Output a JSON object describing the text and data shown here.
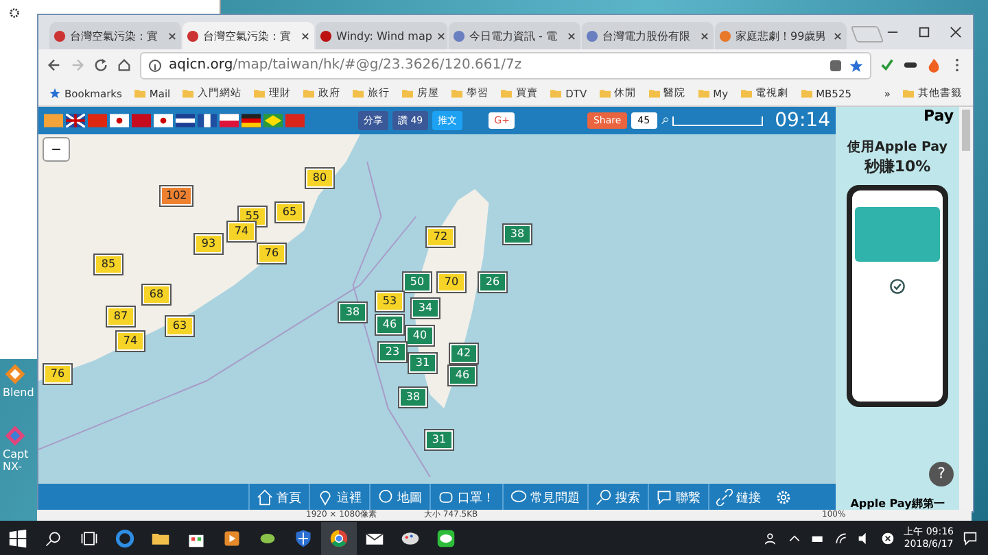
{
  "browser": {
    "tabs": [
      {
        "title": "台灣空氣污染：實",
        "selected": false
      },
      {
        "title": "台灣空氣污染：實",
        "selected": true
      },
      {
        "title": "Windy: Wind map",
        "selected": false
      },
      {
        "title": "今日電力資訊 - 電",
        "selected": false
      },
      {
        "title": "台灣電力股份有限",
        "selected": false
      },
      {
        "title": "家庭悲劇！99歲男",
        "selected": false
      }
    ],
    "address": {
      "host": "aqicn.org",
      "path": "/map/taiwan/hk/#@g/23.3626/120.661/7z"
    },
    "bookmarks": [
      "Bookmarks",
      "Mail",
      "入門網站",
      "理財",
      "政府",
      "旅行",
      "房屋",
      "學習",
      "買賣",
      "DTV",
      "休閒",
      "醫院",
      "My",
      "電視劇",
      "MB525"
    ],
    "bookmarks_more": "»",
    "other_bookmarks": "其他書籤"
  },
  "site_toolbar": {
    "share": "分享",
    "like": "讚",
    "like_count": "49",
    "tweet": "推文",
    "gplus": "G+",
    "share_button": "Share",
    "share_count": "45",
    "clock": "09:14"
  },
  "map": {
    "zoom_out": "−",
    "markers": [
      {
        "value": "102",
        "color": "#ee8130"
      },
      {
        "value": "80",
        "color": "#f5d327"
      },
      {
        "value": "55",
        "color": "#f5d327"
      },
      {
        "value": "65",
        "color": "#f5d327"
      },
      {
        "value": "93",
        "color": "#f5d327"
      },
      {
        "value": "74",
        "color": "#f5d327"
      },
      {
        "value": "76",
        "color": "#f5d327"
      },
      {
        "value": "85",
        "color": "#f5d327"
      },
      {
        "value": "68",
        "color": "#f5d327"
      },
      {
        "value": "87",
        "color": "#f5d327"
      },
      {
        "value": "63",
        "color": "#f5d327"
      },
      {
        "value": "74",
        "color": "#f5d327"
      },
      {
        "value": "76",
        "color": "#f5d327"
      },
      {
        "value": "38",
        "color": "#1d8a5c"
      },
      {
        "value": "72",
        "color": "#f5d327"
      },
      {
        "value": "50",
        "color": "#1d8a5c"
      },
      {
        "value": "70",
        "color": "#f5d327"
      },
      {
        "value": "53",
        "color": "#f5d327"
      },
      {
        "value": "34",
        "color": "#1d8a5c"
      },
      {
        "value": "46",
        "color": "#1d8a5c"
      },
      {
        "value": "40",
        "color": "#1d8a5c"
      },
      {
        "value": "23",
        "color": "#1d8a5c"
      },
      {
        "value": "31",
        "color": "#1d8a5c"
      },
      {
        "value": "42",
        "color": "#1d8a5c"
      },
      {
        "value": "46",
        "color": "#1d8a5c"
      },
      {
        "value": "38",
        "color": "#1d8a5c"
      },
      {
        "value": "31",
        "color": "#1d8a5c"
      },
      {
        "value": "26",
        "color": "#1d8a5c"
      },
      {
        "value": "38",
        "color": "#1d8a5c"
      }
    ]
  },
  "ad": {
    "brand": "Pay",
    "headline": "使用Apple Pay",
    "offer": "秒賺10%",
    "footer": "Apple Pay綁第一",
    "help": "?"
  },
  "bottom_nav": [
    "首頁",
    "這裡",
    "地圖",
    "口罩！",
    "常見問題",
    "搜索",
    "聯繫",
    "鏈接"
  ],
  "viewer_status": {
    "dimensions": "1920 × 1080像素",
    "size": "大小 747.5KB",
    "zoom": "100%"
  },
  "desktop_icons": [
    "Blend",
    "Capt NX-"
  ],
  "taskbar": {
    "time": "上午 09:16",
    "date": "2018/6/17"
  }
}
